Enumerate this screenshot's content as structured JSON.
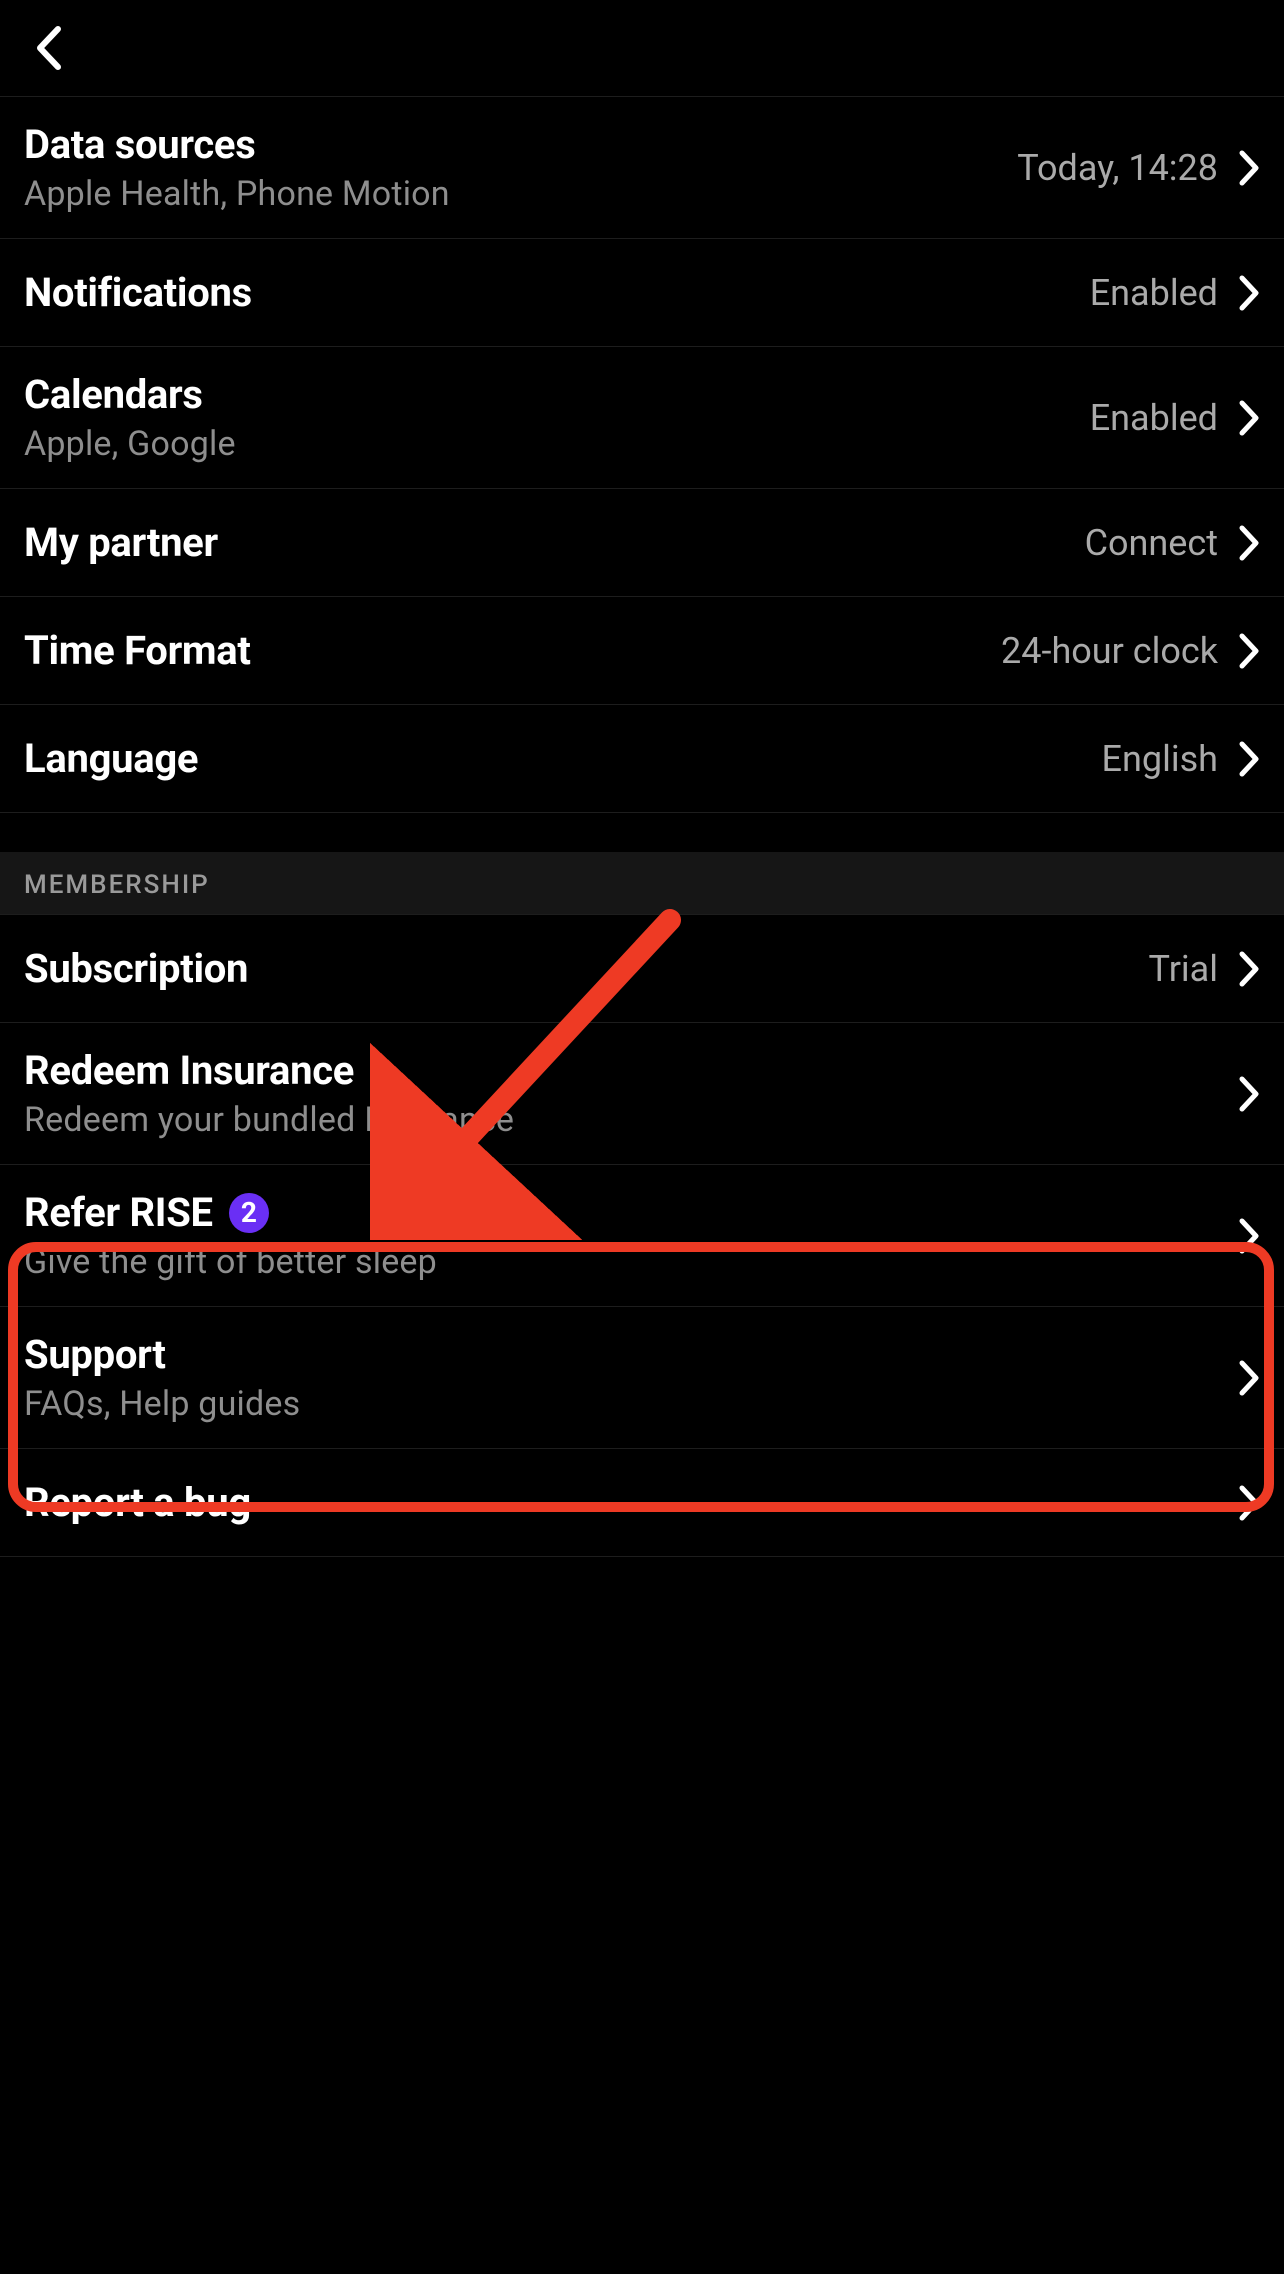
{
  "colors": {
    "bg": "#000000",
    "text": "#ffffff",
    "muted": "#8e8e8e",
    "value": "#aaaaaa",
    "divider": "#1d1d1d",
    "section_bg": "#161616",
    "badge_bg": "#6a2ff5",
    "annotation": "#ee3a24"
  },
  "rows": {
    "data_sources": {
      "title": "Data sources",
      "sub": "Apple Health, Phone Motion",
      "value": "Today, 14:28"
    },
    "notifications": {
      "title": "Notifications",
      "value": "Enabled"
    },
    "calendars": {
      "title": "Calendars",
      "sub": "Apple, Google",
      "value": "Enabled"
    },
    "partner": {
      "title": "My partner",
      "value": "Connect"
    },
    "time_format": {
      "title": "Time Format",
      "value": "24-hour clock"
    },
    "language": {
      "title": "Language",
      "value": "English"
    },
    "subscription": {
      "title": "Subscription",
      "value": "Trial"
    },
    "redeem_insurance": {
      "title": "Redeem Insurance",
      "sub": "Redeem your bundled Insurance"
    },
    "refer": {
      "title": "Refer RISE",
      "badge": "2",
      "sub": "Give the gift of better sleep"
    },
    "support": {
      "title": "Support",
      "sub": "FAQs, Help guides"
    },
    "report_bug": {
      "title": "Report a bug"
    }
  },
  "sections": {
    "membership": "MEMBERSHIP"
  }
}
